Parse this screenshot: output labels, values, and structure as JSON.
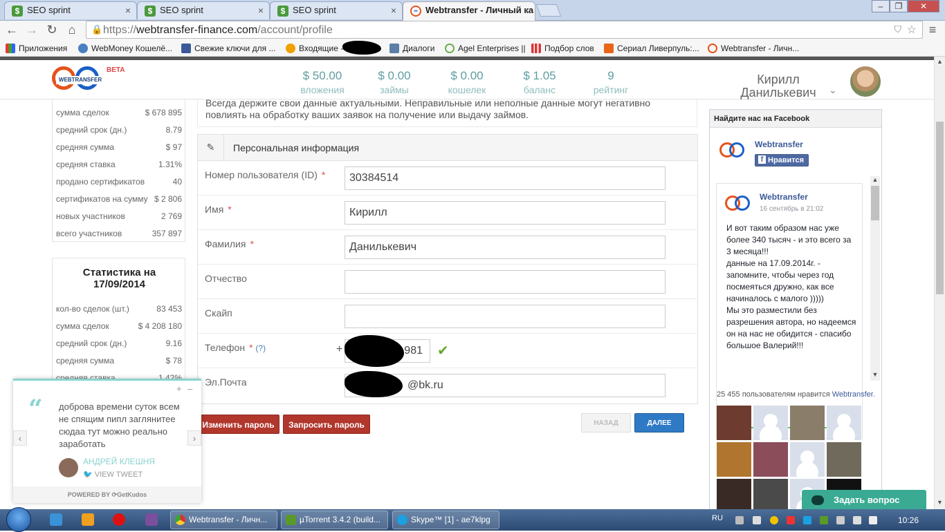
{
  "browser": {
    "tabs": [
      {
        "title": "SEO sprint",
        "close": "×"
      },
      {
        "title": "SEO sprint",
        "close": "×"
      },
      {
        "title": "SEO sprint",
        "close": "×"
      },
      {
        "title": "Webtransfer - Личный ка",
        "close": "×"
      }
    ],
    "url": {
      "scheme": "https://",
      "host": "webtransfer-finance.com",
      "path": "/account/profile"
    },
    "bookmarks": [
      "Приложения",
      "WebMoney Кошелё...",
      "Свежие ключи для ...",
      "Входящие -",
      "Диалоги",
      "Agel Enterprises ||",
      "Подбор слов",
      "Сериал Ливерпуль:...",
      "Webtransfer - Личн..."
    ]
  },
  "header": {
    "logo_text": "WEBTRANSFER",
    "beta": "BETA",
    "stats": [
      {
        "value": "$ 50.00",
        "label": "вложения"
      },
      {
        "value": "$ 0.00",
        "label": "займы"
      },
      {
        "value": "$ 0.00",
        "label": "кошелек"
      },
      {
        "value": "$ 1.05",
        "label": "баланс"
      },
      {
        "value": "9",
        "label": "рейтинг"
      }
    ],
    "user_first": "Кирилл",
    "user_last": "Данилькевич"
  },
  "sidebar": {
    "box1_rows": [
      {
        "label": "сумма сделок",
        "value": "$ 678 895"
      },
      {
        "label": "средний срок (дн.)",
        "value": "8.79"
      },
      {
        "label": "средняя сумма",
        "value": "$ 97"
      },
      {
        "label": "средняя ставка",
        "value": "1.31%"
      },
      {
        "label": "продано сертификатов",
        "value": "40"
      },
      {
        "label": "сертификатов на сумму",
        "value": "$ 2 806"
      },
      {
        "label": "новых участников",
        "value": "2 769"
      },
      {
        "label": "всего участников",
        "value": "357 897"
      }
    ],
    "box2_title_1": "Статистика на",
    "box2_title_2": "17/09/2014",
    "box2_rows": [
      {
        "label": "кол-во сделок (шт.)",
        "value": "83 453"
      },
      {
        "label": "сумма сделок",
        "value": "$ 4 208 180"
      },
      {
        "label": "средний срок (дн.)",
        "value": "9.16"
      },
      {
        "label": "средняя сумма",
        "value": "$ 78"
      },
      {
        "label": "средняя ставка",
        "value": "1.42%"
      }
    ]
  },
  "main": {
    "notice": "Всегда держите свои данные актуальными. Неправильные или неполные данные могут негативно повлиять на обработку ваших заявок на получение или выдачу займов.",
    "section_title": "Персональная информация",
    "fields": [
      {
        "label": "Номер пользователя (ID)",
        "required": "*",
        "value": "30384514"
      },
      {
        "label": "Имя",
        "required": "*",
        "value": "Кирилл"
      },
      {
        "label": "Фамилия",
        "required": "*",
        "value": "Данилькевич"
      },
      {
        "label": "Отчество",
        "required": "",
        "value": ""
      },
      {
        "label": "Скайп",
        "required": "",
        "value": ""
      },
      {
        "label": "Телефон",
        "required": "*",
        "help": "(?)",
        "prefix": "+",
        "value": "981"
      },
      {
        "label": "Эл.Почта",
        "required": "",
        "value": "@bk.ru"
      }
    ],
    "buttons": {
      "change_password": "Изменить пароль",
      "request_password": "Запросить пароль",
      "back": "НАЗАД",
      "next": "ДАЛЕЕ"
    }
  },
  "facebook": {
    "header": "Найдите нас на Facebook",
    "page_name": "Webtransfer",
    "like_button": "Нравится",
    "post_author": "Webtransfer",
    "post_date": "16 сентябрь в 21:02",
    "post_text": "И вот таким образом нас уже более 340 тысяч - и это всего за 3 месяца!!!\nданные на 17.09.2014г. - запомните, чтобы через год посмеяться дружно, как все начиналось с малого )))))\nМы это разместили без разрешения автора, но надеемся он на нас не обидится - спасибо большое Валерий!!!",
    "fans_text": "25 455 пользователям нравится",
    "fans_page": "Webtransfer."
  },
  "tweet": {
    "text": "доброва времени суток всем не спящим пипл заглянитее сюдаа тут можно реально заработать",
    "author": "АНДРЕЙ КЛЕШНЯ",
    "view": "VIEW TWEET",
    "powered": "POWERED BY ⟳GetKudos"
  },
  "ask_button": "Задать вопрос",
  "taskbar": {
    "apps": [
      "Webtransfer - Личн...",
      "µTorrent 3.4.2  (build...",
      "Skype™ [1] - ae7klpg"
    ],
    "lang": "RU",
    "clock": "10:26"
  },
  "colors": {
    "accent_teal": "#5f9ea0",
    "button_red": "#b1362c",
    "button_blue": "#2f7ac5",
    "facebook_blue": "#3b5998",
    "kudos_teal": "#8ad3cf"
  }
}
